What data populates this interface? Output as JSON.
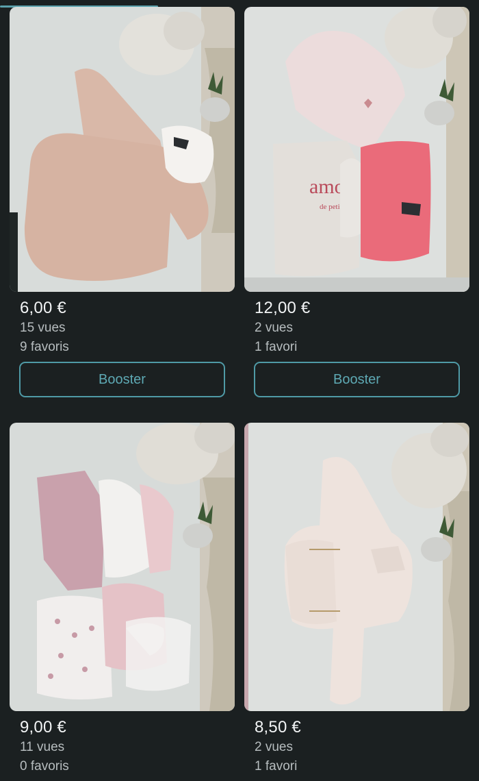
{
  "progress": {
    "fraction": 0.33
  },
  "items": [
    {
      "price": "6,00 €",
      "views": "15 vues",
      "favorites": "9 favoris",
      "button": "Booster",
      "photo": "pink-knit-romper-with-white-collar"
    },
    {
      "price": "12,00 €",
      "views": "2 vues",
      "favorites": "1 favori",
      "button": "Booster",
      "photo": "three-baby-tops-amour"
    },
    {
      "price": "9,00 €",
      "views": "11 vues",
      "favorites": "0 favoris",
      "photo": "baby-bodysuits-set"
    },
    {
      "price": "8,50 €",
      "views": "2 vues",
      "favorites": "1 favori",
      "photo": "cream-quilted-jacket"
    }
  ]
}
